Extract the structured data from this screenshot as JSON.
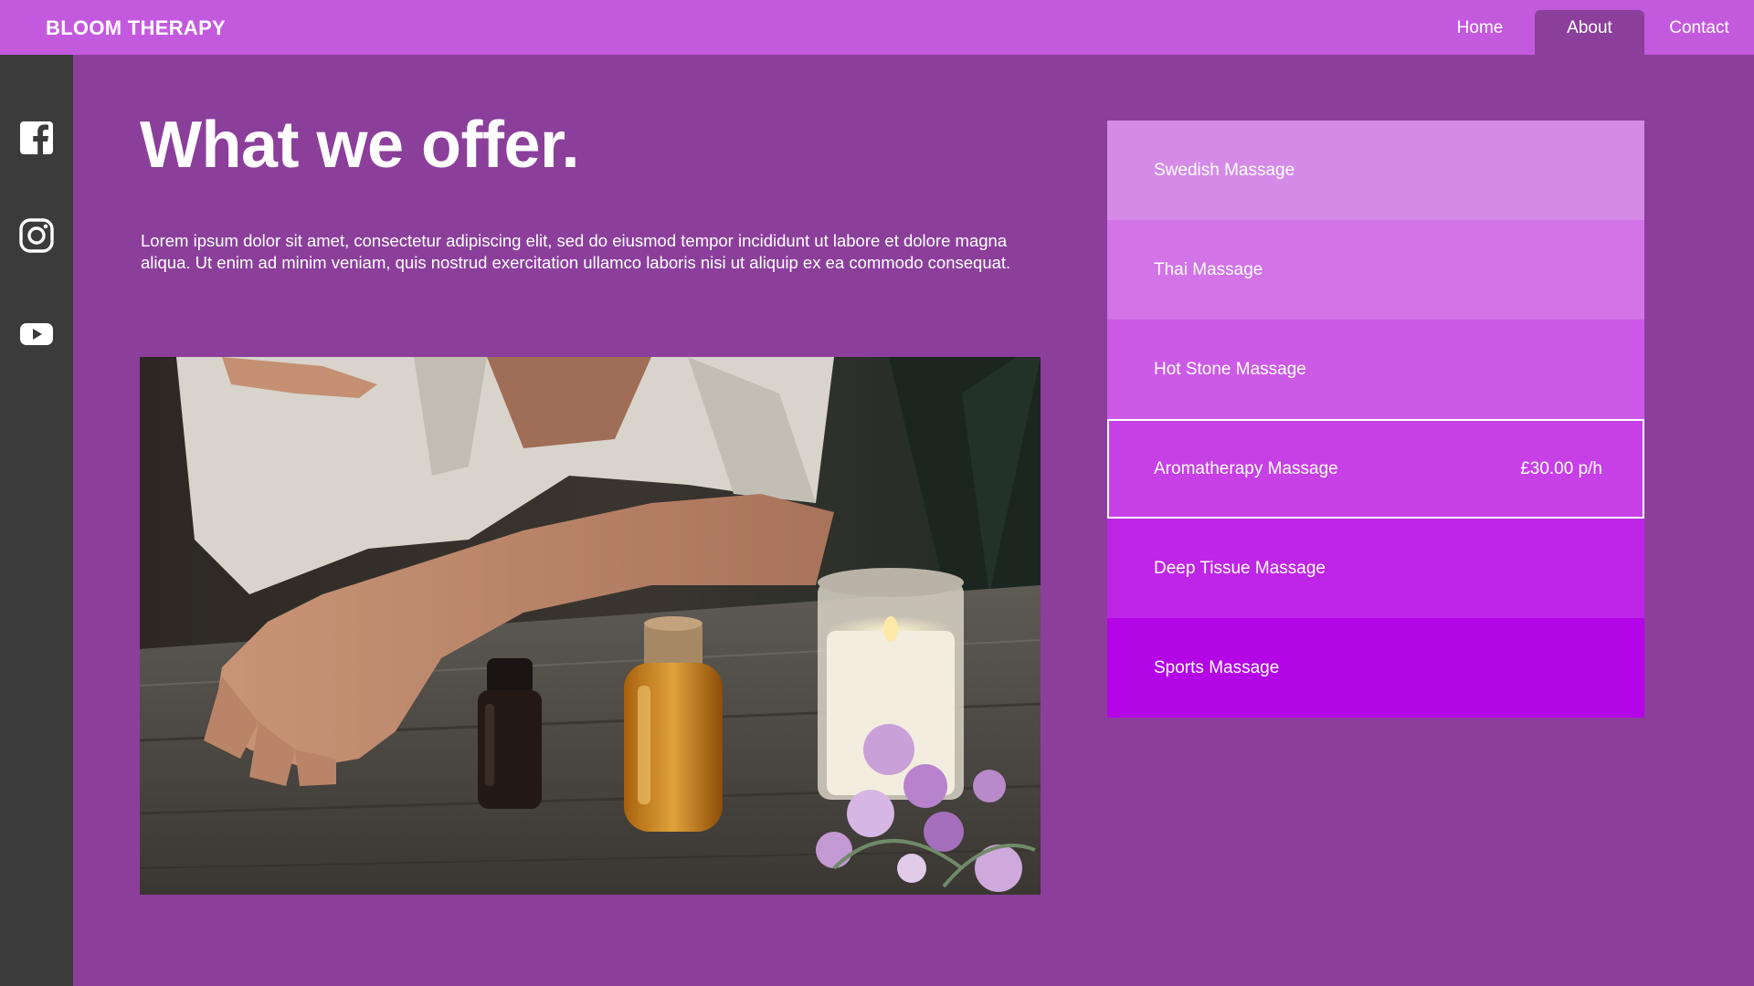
{
  "header": {
    "brand": "BLOOM THERAPY",
    "nav": [
      {
        "label": "Home"
      },
      {
        "label": "About",
        "active": true
      },
      {
        "label": "Contact"
      }
    ]
  },
  "social": [
    {
      "icon": "facebook-icon"
    },
    {
      "icon": "instagram-icon"
    },
    {
      "icon": "youtube-icon"
    }
  ],
  "main": {
    "heading": "What we offer.",
    "intro": "Lorem ipsum dolor sit amet, consectetur adipiscing elit, sed do eiusmod tempor incididunt ut labore et dolore magna aliqua. Ut enim ad minim veniam, quis nostrud exercitation ullamco laboris nisi ut aliquip ex ea commodo consequat."
  },
  "services": [
    {
      "name": "Swedish Massage",
      "price": "",
      "color": "#d58ae8"
    },
    {
      "name": "Thai Massage",
      "price": "",
      "color": "#d273e8"
    },
    {
      "name": "Hot Stone Massage",
      "price": "",
      "color": "#cc5ae6"
    },
    {
      "name": "Aromatherapy Massage",
      "price": "£30.00 p/h",
      "color": "#c640e6",
      "selected": true
    },
    {
      "name": "Deep Tissue Massage",
      "price": "",
      "color": "#bf25e6"
    },
    {
      "name": "Sports Massage",
      "price": "",
      "color": "#b305e6"
    }
  ],
  "colors": {
    "page_bg": "#8b3f9b",
    "header_bg": "#c35ade",
    "sidebar_bg": "#3b3b3b"
  }
}
